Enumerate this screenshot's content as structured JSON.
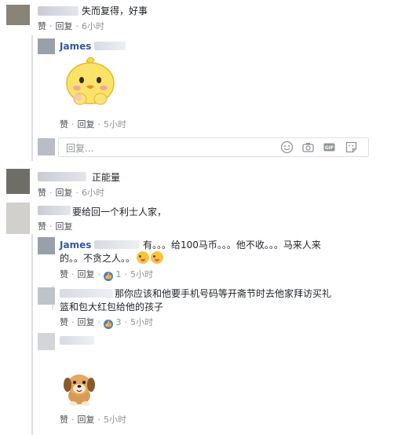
{
  "comments": {
    "c1": {
      "text": "失而复得，好事",
      "like": "赞",
      "reply": "回复",
      "time": "6小时"
    },
    "r1": {
      "name": "James",
      "sticker": "yellow-chick-sticker",
      "like": "赞",
      "reply": "回复",
      "time": "5小时"
    },
    "reply_box": {
      "placeholder": "回复..."
    },
    "c2": {
      "text": "正能量",
      "like": "赞",
      "reply": "回复",
      "time": "6小时"
    },
    "c3": {
      "text": "要给回一个利士人家，",
      "like": "赞",
      "reply": "回复",
      "time": ""
    },
    "r3a": {
      "name": "James",
      "text_line1": "有。。。给100马币。。。他不收。。。马来人来",
      "text_line2": "的。。不贪之人。。",
      "like": "赞",
      "reply": "回复",
      "likes": "1",
      "time": "5小时"
    },
    "r3b": {
      "text_line1": "那你应该和他要手机号码等开斋节时去他家拜访买礼",
      "text_line2": "篮和包大红包给他的孩子",
      "like": "赞",
      "reply": "回复",
      "likes": "3",
      "time": "5小时"
    },
    "r3c": {
      "sticker": "puppy-sticker",
      "like": "赞",
      "reply": "回复",
      "time": "5小时"
    }
  },
  "icons": [
    "smiley-icon",
    "camera-icon",
    "gif-icon",
    "sticker-icon",
    "like-icon"
  ],
  "colors": {
    "name": "#365899",
    "meta": "#90949c",
    "like_badge": "#4c7cdb"
  }
}
